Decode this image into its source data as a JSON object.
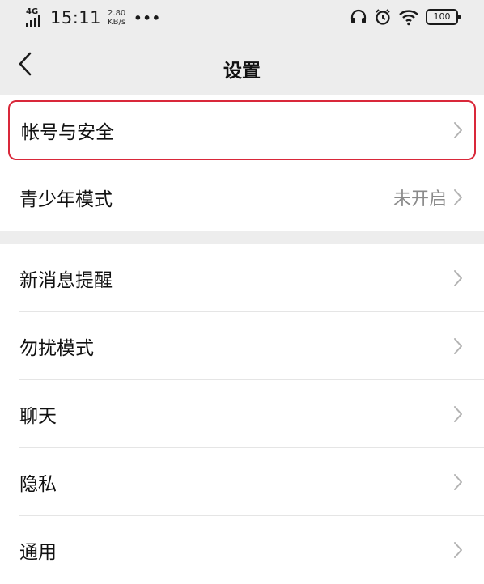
{
  "status_bar": {
    "network": "4G",
    "time": "15:11",
    "speed_value": "2.80",
    "speed_unit": "KB/s",
    "more": "•••",
    "battery": "100",
    "icons": [
      "headset-icon",
      "alarm-icon",
      "wifi-icon",
      "battery-icon"
    ]
  },
  "nav": {
    "back_icon": "chevron-left-icon",
    "title": "设置"
  },
  "groups": [
    {
      "items": [
        {
          "label": "帐号与安全",
          "value": "",
          "highlighted": true
        },
        {
          "label": "青少年模式",
          "value": "未开启",
          "highlighted": false
        }
      ]
    },
    {
      "items": [
        {
          "label": "新消息提醒",
          "value": ""
        },
        {
          "label": "勿扰模式",
          "value": ""
        },
        {
          "label": "聊天",
          "value": ""
        },
        {
          "label": "隐私",
          "value": ""
        },
        {
          "label": "通用",
          "value": ""
        }
      ]
    }
  ],
  "colors": {
    "background_gray": "#ededed",
    "highlight_border": "#d9283a",
    "secondary_text": "#8a8a8a",
    "chevron": "#b3b3b3"
  }
}
